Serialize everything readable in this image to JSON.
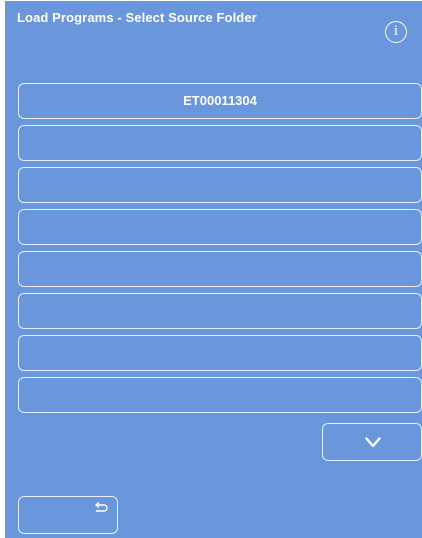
{
  "header": {
    "title": "Load Programs - Select Source Folder",
    "info_glyph": "i",
    "info_icon": "info-icon"
  },
  "folders": [
    {
      "label": "ET00011304"
    },
    {
      "label": ""
    },
    {
      "label": ""
    },
    {
      "label": ""
    },
    {
      "label": ""
    },
    {
      "label": ""
    },
    {
      "label": ""
    },
    {
      "label": ""
    }
  ],
  "controls": {
    "scroll_down_icon": "chevron-down-icon",
    "back_icon": "return-arrow-icon"
  },
  "colors": {
    "background": "#6a96dc",
    "text": "#ffffff",
    "border": "#e6eefb"
  }
}
